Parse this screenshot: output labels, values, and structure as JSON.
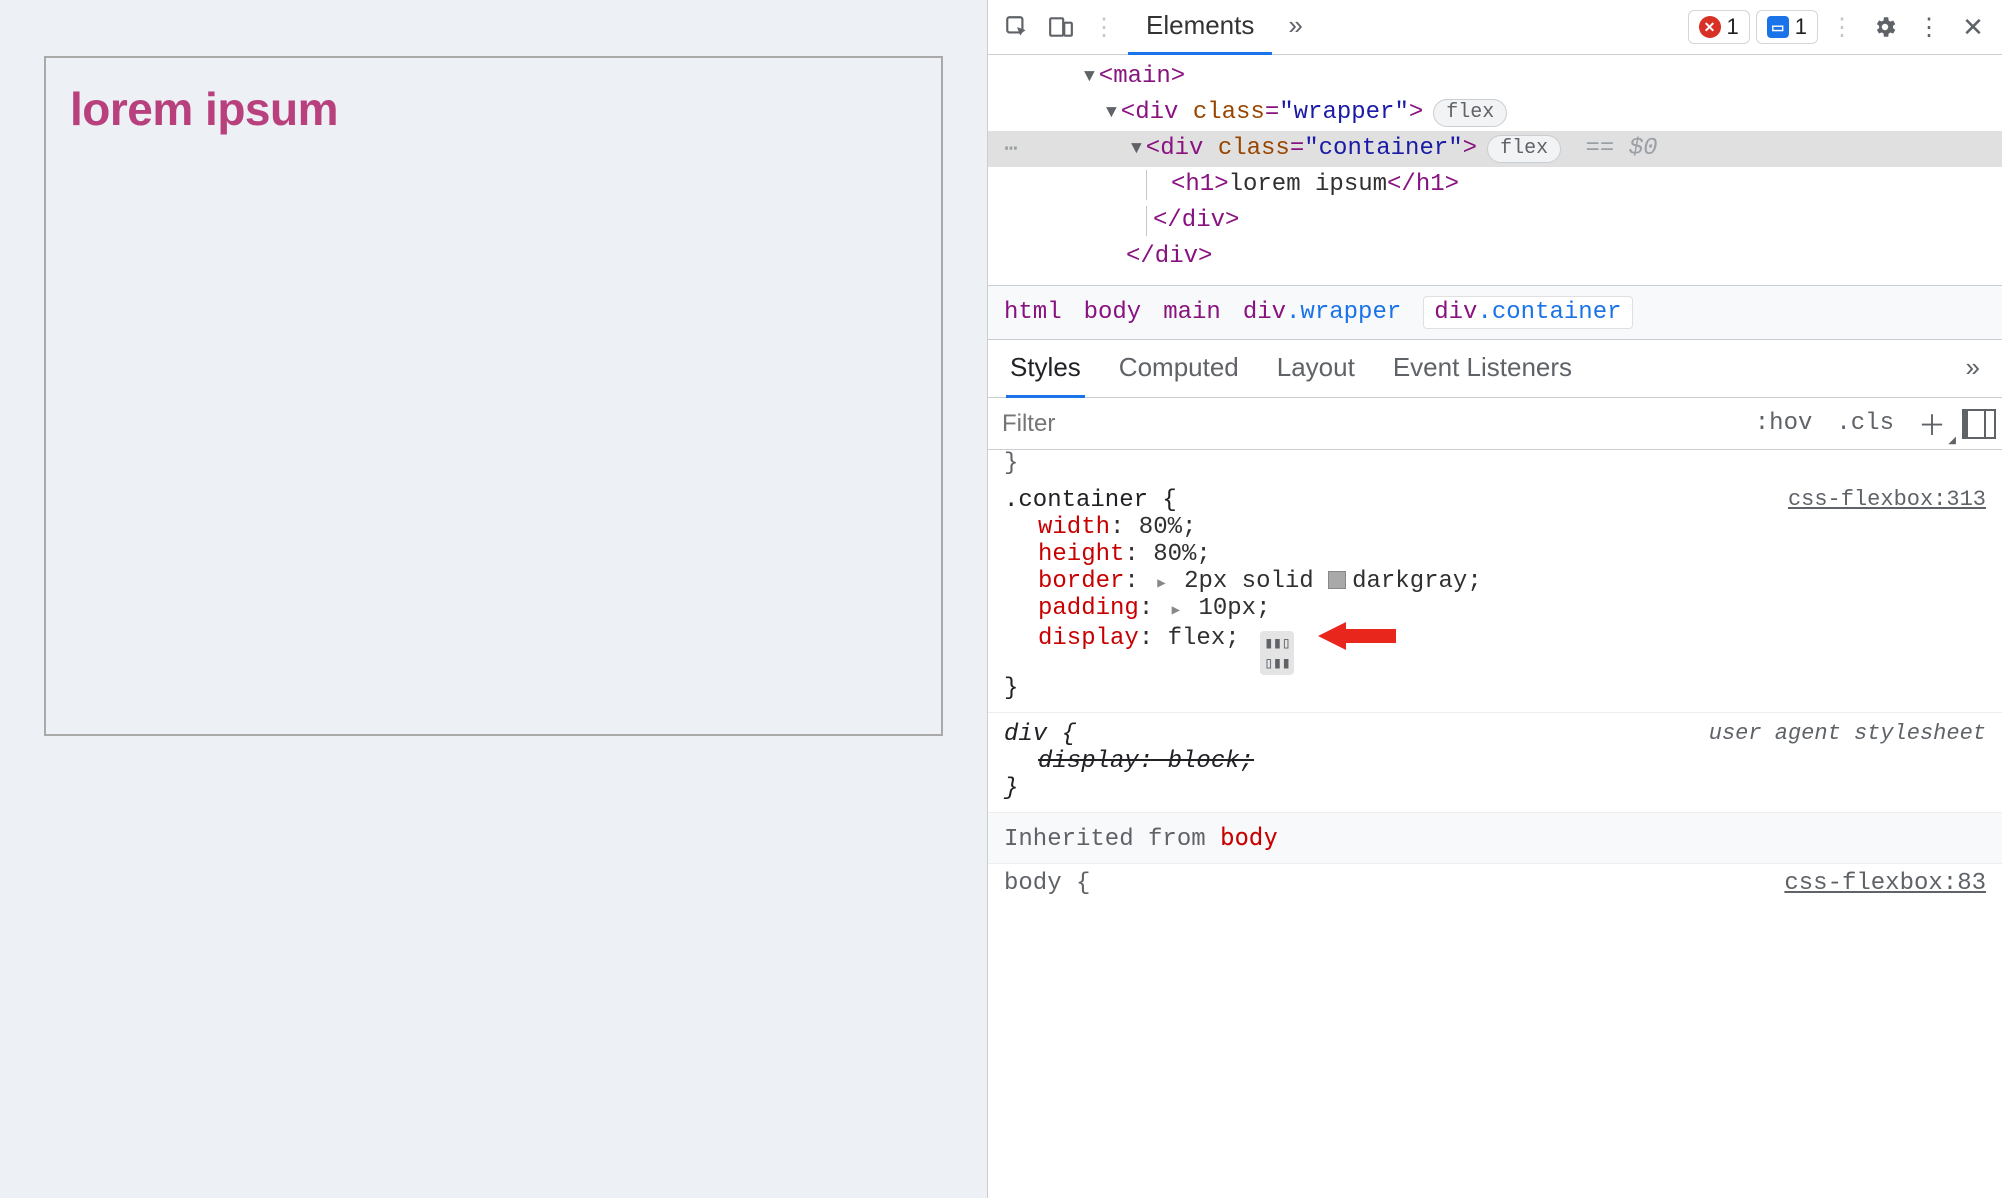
{
  "preview": {
    "heading": "lorem ipsum"
  },
  "toolbar": {
    "tab_elements": "Elements",
    "more": "»",
    "error_count": "1",
    "info_count": "1"
  },
  "dom": {
    "main_open": "<main>",
    "wrapper_open_pre": "<div ",
    "wrapper_class_attr": "class",
    "wrapper_class_val": "\"wrapper\"",
    "wrapper_open_post": ">",
    "wrapper_pill": "flex",
    "container_open_pre": "<div ",
    "container_class_attr": "class",
    "container_class_val": "\"container\"",
    "container_open_post": ">",
    "container_pill": "flex",
    "eq0": " == $0",
    "h1_open": "<h1>",
    "h1_text": "lorem ipsum",
    "h1_close": "</h1>",
    "container_close": "</div>",
    "wrapper_close": "</div>",
    "gutter_dots": "⋯"
  },
  "crumbs": {
    "html": "html",
    "body": "body",
    "main": "main",
    "wrapper_el": "div",
    "wrapper_cls": ".wrapper",
    "container_el": "div",
    "container_cls": ".container"
  },
  "subtabs": {
    "styles": "Styles",
    "computed": "Computed",
    "layout": "Layout",
    "events": "Event Listeners",
    "more": "»"
  },
  "filter": {
    "placeholder": "Filter",
    "hov": ":hov",
    "cls": ".cls"
  },
  "rule_container": {
    "selector": ".container {",
    "source": "css-flexbox:313",
    "p_width_n": "width",
    "p_width_v": ": 80%;",
    "p_height_n": "height",
    "p_height_v": ": 80%;",
    "p_border_n": "border",
    "p_border_v_pre": ": ",
    "p_border_v_post": "2px solid ",
    "p_border_color": "darkgray;",
    "p_padding_n": "padding",
    "p_padding_v": ": ",
    "p_padding_val": "10px;",
    "p_display_n": "display",
    "p_display_v": ": flex;",
    "close": "}"
  },
  "rule_div": {
    "selector": "div {",
    "source": "user agent stylesheet",
    "p_display_full": "display: block;",
    "close": "}"
  },
  "inherited": {
    "label": "Inherited from ",
    "from": "body"
  },
  "partial": {
    "sel": "body {",
    "src": "css-flexbox:83"
  }
}
